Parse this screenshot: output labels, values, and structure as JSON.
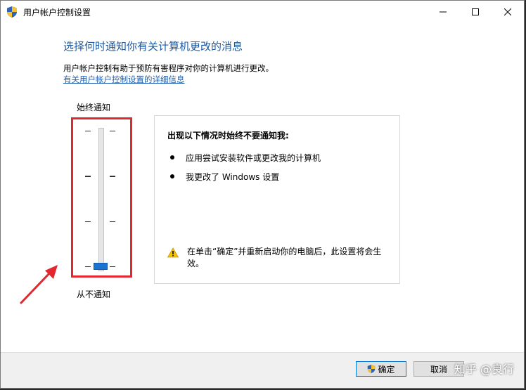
{
  "window": {
    "title": "用户帐户控制设置",
    "icon": "uac-shield-icon"
  },
  "content": {
    "heading": "选择何时通知你有关计算机更改的消息",
    "description": "用户帐户控制有助于预防有害程序对你的计算机进行更改。",
    "link": "有关用户帐户控制设置的详细信息"
  },
  "slider": {
    "top_label": "始终通知",
    "bottom_label": "从不通知",
    "level_count": 4,
    "selected_level": 1,
    "selected_description": "lowest level (Never notify)"
  },
  "info_panel": {
    "title": "出现以下情况时始终不要通知我:",
    "items": [
      "应用尝试安装软件或更改我的计算机",
      "我更改了 Windows 设置"
    ],
    "warning": "在单击“确定”并重新启动你的电脑后，此设置将会生效。"
  },
  "buttons": {
    "ok": "确定",
    "cancel": "取消"
  },
  "watermark": "知乎 @良行",
  "colors": {
    "heading": "#1d5aa0",
    "link": "#1a5fb4",
    "highlight": "#e0282e",
    "thumb": "#1a73d0"
  }
}
